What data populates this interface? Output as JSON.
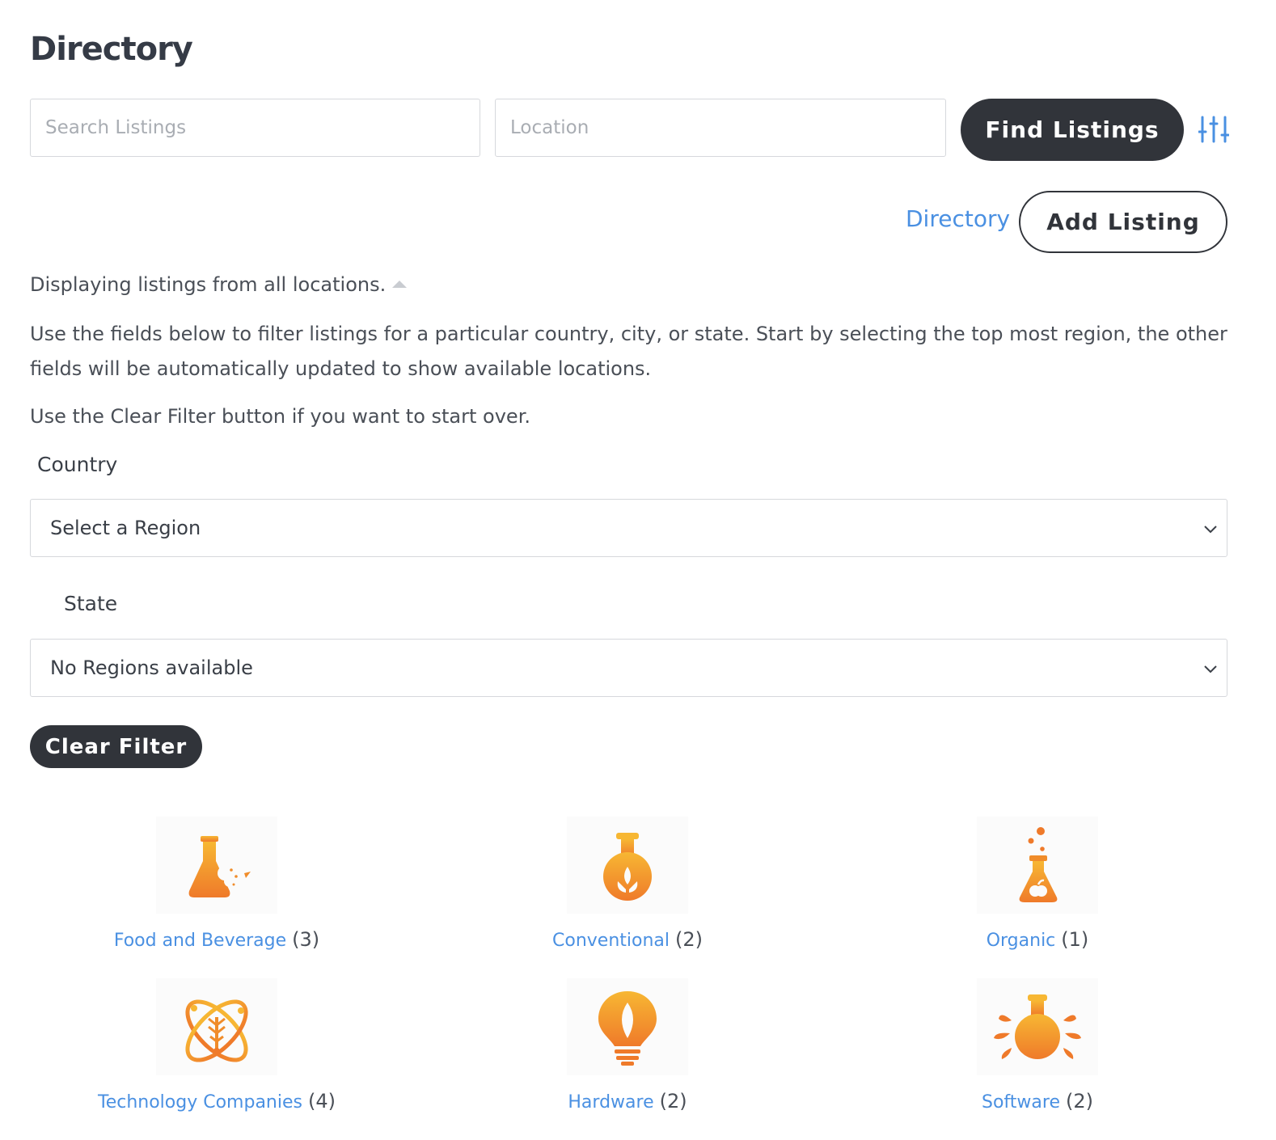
{
  "header": {
    "title": "Directory"
  },
  "search": {
    "query_placeholder": "Search Listings",
    "location_placeholder": "Location",
    "find_label": "Find Listings"
  },
  "nav": {
    "directory_link": "Directory",
    "add_listing_label": "Add Listing"
  },
  "info": {
    "displaying": "Displaying listings from all locations.",
    "intro": "Use the fields below to filter listings for a particular country, city, or state. Start by selecting the top most region, the other fields will be automatically updated to show available locations.",
    "clear_hint": "Use the Clear Filter button if you want to start over."
  },
  "filters": {
    "country_label": "Country",
    "country_value": "Select a Region",
    "state_label": "State",
    "state_value": "No Regions available",
    "clear_label": "Clear Filter"
  },
  "categories": [
    {
      "name": "Food and Beverage",
      "count": "(3)",
      "icon": "flask-food-icon"
    },
    {
      "name": "Conventional",
      "count": "(2)",
      "icon": "flask-sprout-icon"
    },
    {
      "name": "Organic",
      "count": "(1)",
      "icon": "flask-apple-icon"
    },
    {
      "name": "Technology Companies",
      "count": "(4)",
      "icon": "atom-plant-icon"
    },
    {
      "name": "Hardware",
      "count": "(2)",
      "icon": "lightbulb-leaf-icon"
    },
    {
      "name": "Software",
      "count": "(2)",
      "icon": "flask-leaves-icon"
    }
  ],
  "colors": {
    "accent_link": "#4a90e2",
    "dark_button": "#31343a",
    "icon_orange": "#f08c2a",
    "icon_yellow": "#f7b733"
  }
}
